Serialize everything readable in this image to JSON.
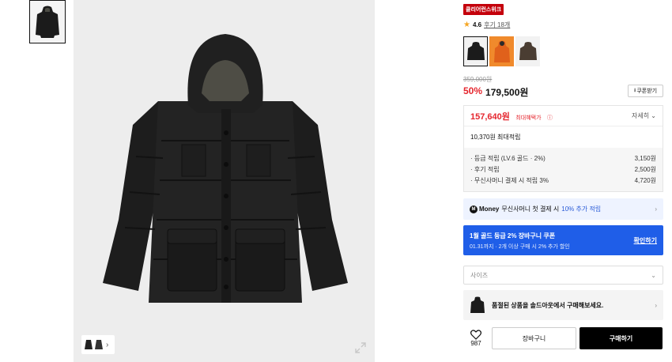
{
  "badge": "클리어런스위크",
  "rating": {
    "score": "4.6",
    "reviews": "후기 18개"
  },
  "price": {
    "original": "359,000원",
    "discount_rate": "50%",
    "sale": "179,500원"
  },
  "coupon_button": "쿠폰받기",
  "benefits": {
    "max_price": "157,640원",
    "max_label": "최대혜택가",
    "detail_label": "자세히",
    "max_points": "10,370원 최대적립",
    "rows": [
      {
        "label": "· 등급 적립 (LV.6 골드 · 2%)",
        "value": "3,150원"
      },
      {
        "label": "· 후기 적립",
        "value": "2,500원"
      },
      {
        "label": "· 무신사머니 결제 시 적립 3%",
        "value": "4,720원"
      }
    ]
  },
  "money_banner": {
    "brand": "Money",
    "text": "무신사머니 첫 결제 시",
    "highlight": "10% 추가 적립"
  },
  "coupon_banner": {
    "title": "1월 골드 등급 2% 장바구니 쿠폰",
    "subtitle": "01.31까지 · 2개 이상 구매 시 2% 추가 할인",
    "action": "확인하기"
  },
  "size_select": {
    "placeholder": "사이즈"
  },
  "soldout_banner": "품절된 상품을 솔드아웃에서 구매해보세요.",
  "like_count": "987",
  "cart_button": "장바구니",
  "buy_button": "구매하기",
  "colors": {
    "accent_red": "#e5262e",
    "badge_red": "#c4000b",
    "blue": "#1f5ee8"
  },
  "icons": [
    "star-icon",
    "download-icon",
    "info-icon",
    "chevron-down-icon",
    "chevron-right-icon",
    "heart-icon",
    "zoom-icon"
  ]
}
